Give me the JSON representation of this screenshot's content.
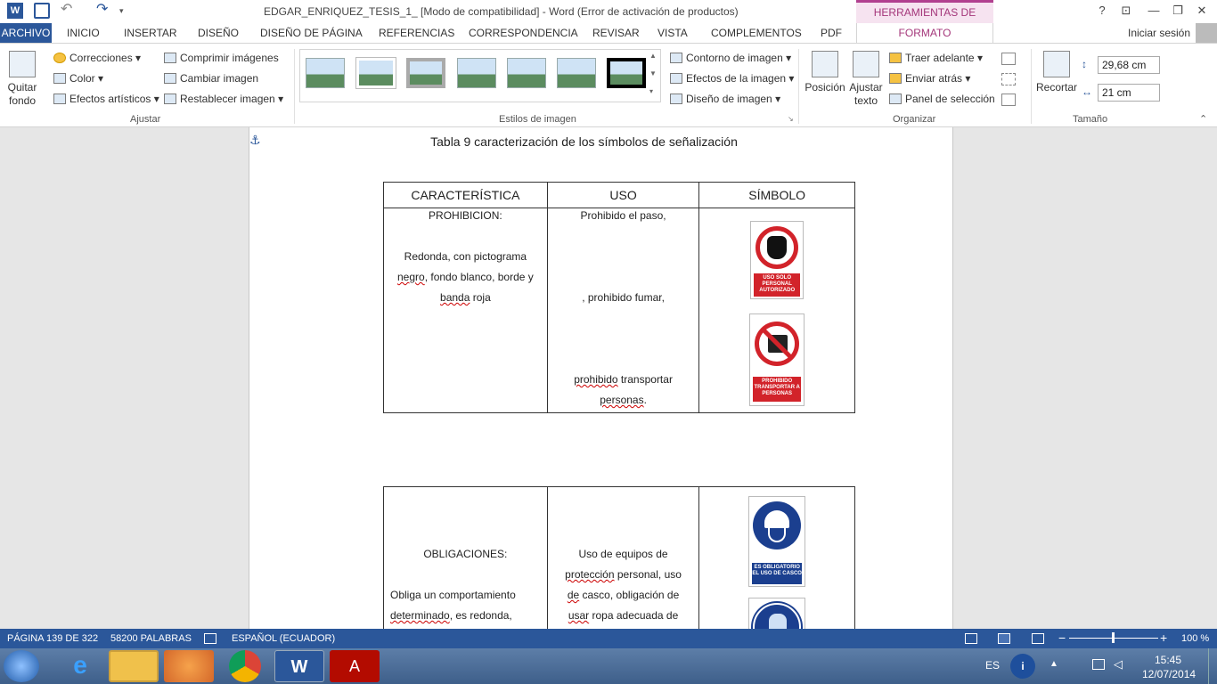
{
  "title_bar": {
    "title": "EDGAR_ENRIQUEZ_TESIS_1_ [Modo de compatibilidad] - Word (Error de activación de productos)",
    "contextual_tab_header": "HERRAMIENTAS DE IMAGEN",
    "help": "?",
    "restore": "⊡",
    "minimize": "—",
    "maximize": "❐",
    "close": "✕"
  },
  "tabs": {
    "archivo": "ARCHIVO",
    "items": [
      "INICIO",
      "INSERTAR",
      "DISEÑO",
      "DISEÑO DE PÁGINA",
      "REFERENCIAS",
      "CORRESPONDENCIA",
      "REVISAR",
      "VISTA",
      "COMPLEMENTOS",
      "PDF"
    ],
    "formato": "FORMATO",
    "signin": "Iniciar sesión"
  },
  "ribbon": {
    "ajustar": {
      "label": "Ajustar",
      "quitar_fondo": "Quitar fondo",
      "correcciones": "Correcciones",
      "color": "Color",
      "efectos_artisticos": "Efectos artísticos",
      "comprimir": "Comprimir imágenes",
      "cambiar": "Cambiar imagen",
      "restablecer": "Restablecer imagen"
    },
    "estilos": {
      "label": "Estilos de imagen",
      "contorno": "Contorno de imagen",
      "efectos": "Efectos de la imagen",
      "diseno": "Diseño de imagen"
    },
    "organizar": {
      "label": "Organizar",
      "posicion": "Posición",
      "ajustar_texto": "Ajustar texto",
      "traer_adelante": "Traer adelante",
      "enviar_atras": "Enviar atrás",
      "panel_seleccion": "Panel de selección"
    },
    "tamano": {
      "label": "Tamaño",
      "recortar": "Recortar",
      "height": "29,68 cm",
      "width": "21 cm"
    }
  },
  "document": {
    "caption": "Tabla 9 caracterización de los símbolos de señalización",
    "table1": {
      "headers": [
        "CARACTERÍSTICA",
        "USO",
        "SÍMBOLO"
      ],
      "col1_title": "PROHIBICION:",
      "col1_text_1": "Redonda, con pictograma",
      "col1_text_2a": "negro",
      "col1_text_2b": ", fondo blanco, borde y",
      "col1_text_3a": "banda",
      "col1_text_3b": " roja",
      "col2_line1": "Prohibido el paso,",
      "col2_line2": ", prohibido fumar,",
      "col2_line3a": "prohibido",
      "col2_line3b": " transportar",
      "col2_line4": "personas",
      "col2_line4_end": ".",
      "sign1_text": "USO SOLO PERSONAL AUTORIZADO",
      "sign2_text": "PROHIBIDO TRANSPORTAR A PERSONAS"
    },
    "table2": {
      "col1_title": "OBLIGACIONES:",
      "col1_text_1": "Obliga un comportamiento",
      "col1_text_2a": "determinado",
      "col1_text_2b": ", es redonda,",
      "col2_line1": "Uso de equipos de",
      "col2_line2a": "protección",
      "col2_line2b": " personal, uso",
      "col2_line3a": "de",
      "col2_line3b": " casco, obligación de",
      "col2_line4a": "usar",
      "col2_line4b": " ropa adecuada de",
      "sign3_text": "ES OBLIGATORIO EL USO DE CASCO"
    }
  },
  "status_bar": {
    "page": "PÁGINA 139 DE 322",
    "words": "58200 PALABRAS",
    "language": "ESPAÑOL (ECUADOR)",
    "zoom": "100 %"
  },
  "taskbar": {
    "lang": "ES",
    "time": "15:45",
    "date": "12/07/2014"
  },
  "colors": {
    "word_blue": "#2b579a",
    "contextual_pink": "#a4367a",
    "sign_red": "#d2232a",
    "sign_blue": "#1b3f8f"
  }
}
